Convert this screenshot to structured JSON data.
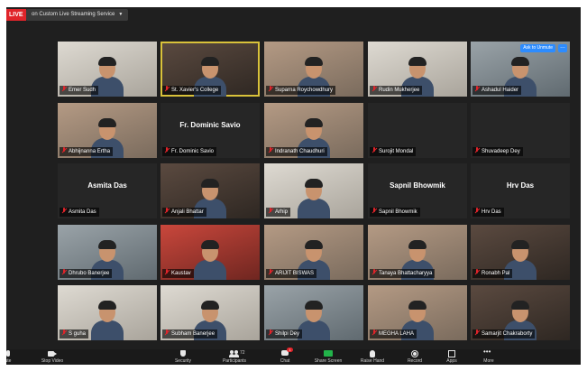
{
  "topbar": {
    "live_label": "LIVE",
    "stream_label": "on Custom Live Streaming Service"
  },
  "tiles": [
    {
      "name": "Emer Sudh",
      "type": "video",
      "tone": "bright"
    },
    {
      "name": "St. Xavier's College",
      "type": "video",
      "tone": "dark",
      "active": true
    },
    {
      "name": "Suparna Roychowdhury",
      "type": "video",
      "tone": "warm"
    },
    {
      "name": "Rudin Mukherjee",
      "type": "video",
      "tone": "bright"
    },
    {
      "name": "Ashadul Haider",
      "type": "video",
      "tone": "cool",
      "ask_unmute": "Ask to Unmute"
    },
    {
      "name": "Abhijnanna Ertha",
      "type": "video",
      "tone": "warm"
    },
    {
      "name": "Fr. Dominic Savio",
      "type": "blank",
      "display_name": "Fr. Dominic Savio"
    },
    {
      "name": "Indranath Chaudhuri",
      "type": "video",
      "tone": "warm"
    },
    {
      "name": "Surojit Mondal",
      "type": "blank"
    },
    {
      "name": "Shuvadeep Dey",
      "type": "blank"
    },
    {
      "name": "Asmita Das",
      "type": "blank",
      "display_name": "Asmita Das"
    },
    {
      "name": "Anjali Bhattar",
      "type": "video",
      "tone": "dark"
    },
    {
      "name": "Arhip",
      "type": "video",
      "tone": "bright"
    },
    {
      "name": "Sapnil Bhowmik",
      "type": "blank",
      "display_name": "Sapnil Bhowmik"
    },
    {
      "name": "Hrv Das",
      "type": "blank",
      "display_name": "Hrv Das"
    },
    {
      "name": "Dhrubo Banerjee",
      "type": "video",
      "tone": "cool"
    },
    {
      "name": "Kaustav",
      "type": "video",
      "tone": "red"
    },
    {
      "name": "ARIJIT BISWAS",
      "type": "video",
      "tone": "warm"
    },
    {
      "name": "Tanaya Bhattacharyya",
      "type": "video",
      "tone": "warm"
    },
    {
      "name": "Ronabh Pal",
      "type": "video",
      "tone": "dark"
    },
    {
      "name": "S guha",
      "type": "video",
      "tone": "bright"
    },
    {
      "name": "Subham Banerjee",
      "type": "video",
      "tone": "bright"
    },
    {
      "name": "Shilpi Dey",
      "type": "video",
      "tone": "cool"
    },
    {
      "name": "MEGHA LAHA",
      "type": "video",
      "tone": "warm"
    },
    {
      "name": "Samarjit Chakraborty",
      "type": "video",
      "tone": "dark"
    }
  ],
  "toolbar": {
    "mute_label": "ute",
    "video_label": "Stop Video",
    "security_label": "Security",
    "participants_label": "Participants",
    "participants_count": "72",
    "chat_label": "Chat",
    "chat_badge": "1",
    "share_label": "Share Screen",
    "raise_hand_label": "Raise Hand",
    "record_label": "Record",
    "apps_label": "Apps",
    "more_label": "More"
  },
  "colors": {
    "live_red": "#e0242a",
    "share_green": "#22b34a",
    "accent_blue": "#2d8cff",
    "active_speaker": "#d9c23a"
  }
}
